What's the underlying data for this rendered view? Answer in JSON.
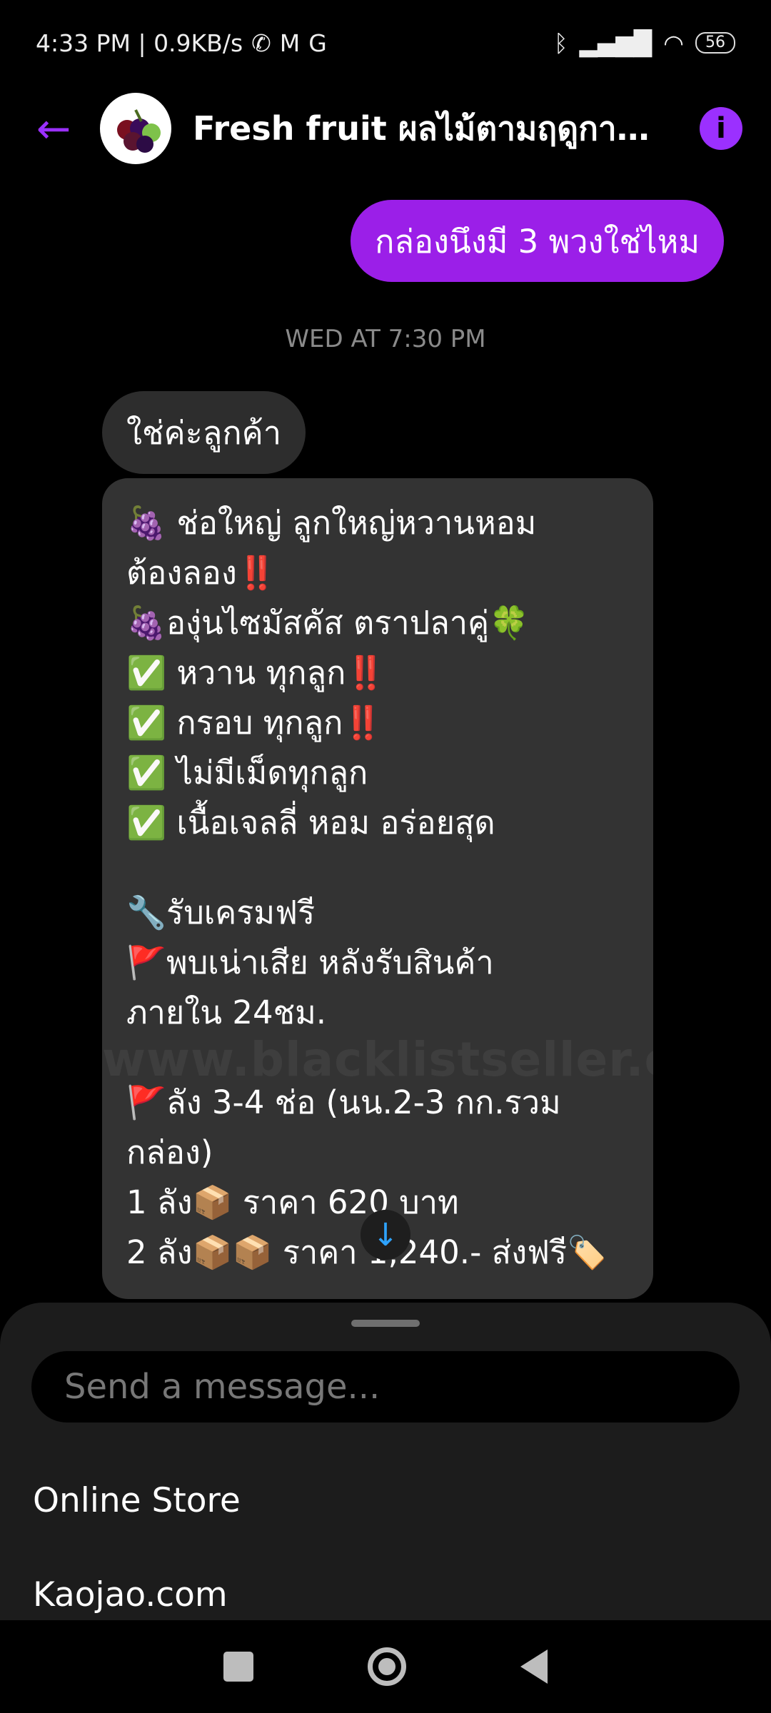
{
  "statusbar": {
    "time": "4:33 PM | 0.9KB/s",
    "icons": [
      "mute-icon",
      "gmail-icon",
      "g-icon"
    ],
    "right_icons": [
      "bluetooth-icon",
      "signal-icon",
      "wifi-icon"
    ],
    "battery": "56"
  },
  "header": {
    "title": "Fresh fruit ผลไม้ตามฤดูกา...",
    "avatar_name": "fruit-avatar"
  },
  "conversation": {
    "outgoing": "กล่องนึงมี 3 พวงใช่ไหม",
    "timestamp": "WED AT 7:30 PM",
    "incoming_short": "ใช่ค่ะลูกค้า",
    "long_message": {
      "watermark": "www.blacklistseller.com",
      "lines": [
        "🍇 ช่อใหญ่ ลูกใหญ่หวานหอม",
        "ต้องลอง‼️",
        "🍇องุ่นไซมัสคัส ตราปลาคู่🍀",
        "✅ หวาน ทุกลูก‼️",
        "✅ กรอบ ทุกลูก‼️",
        "✅ ไม่มีเม็ดทุกลูก",
        "✅ เนื้อเจลลี่ หอม อร่อยสุด",
        "",
        "🔧รับเครมฟรี",
        "🚩พบเน่าเสีย หลังรับสินค้า",
        "ภายใน 24ชม.",
        "",
        "🚩ลัง 3-4 ช่อ (นน.2-3 กก.รวม",
        "กล่อง)",
        "1 ลัง📦 ราคา 620 บาท",
        "2 ลัง📦📦 ราคา 1,240.- ส่งฟรี🏷️"
      ]
    }
  },
  "composer": {
    "placeholder": "Send a message...",
    "shortcuts": [
      "Online Store",
      "Kaojao.com"
    ]
  }
}
